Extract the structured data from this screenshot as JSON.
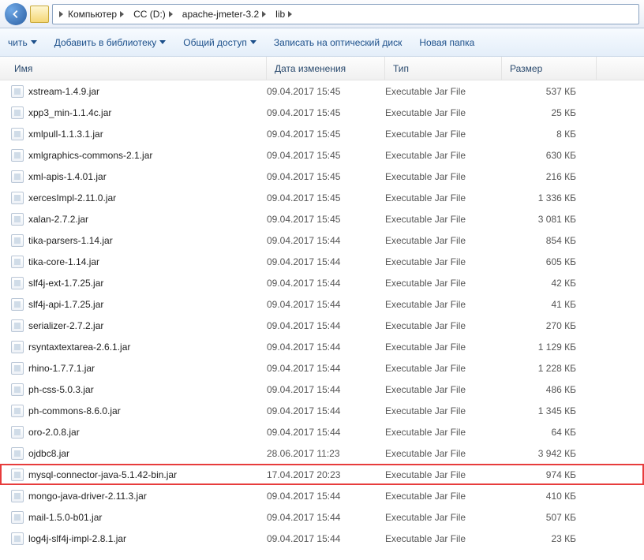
{
  "breadcrumbs": [
    "Компьютер",
    "CC (D:)",
    "apache-jmeter-3.2",
    "lib"
  ],
  "toolbar": {
    "organize": "чить",
    "addlib": "Добавить в библиотеку",
    "share": "Общий доступ",
    "burn": "Записать на оптический диск",
    "newfolder": "Новая папка"
  },
  "columns": {
    "name": "Имя",
    "date": "Дата изменения",
    "type": "Тип",
    "size": "Размер"
  },
  "files": [
    {
      "name": "xstream-1.4.9.jar",
      "date": "09.04.2017 15:45",
      "type": "Executable Jar File",
      "size": "537 КБ",
      "hl": false
    },
    {
      "name": "xpp3_min-1.1.4c.jar",
      "date": "09.04.2017 15:45",
      "type": "Executable Jar File",
      "size": "25 КБ",
      "hl": false
    },
    {
      "name": "xmlpull-1.1.3.1.jar",
      "date": "09.04.2017 15:45",
      "type": "Executable Jar File",
      "size": "8 КБ",
      "hl": false
    },
    {
      "name": "xmlgraphics-commons-2.1.jar",
      "date": "09.04.2017 15:45",
      "type": "Executable Jar File",
      "size": "630 КБ",
      "hl": false
    },
    {
      "name": "xml-apis-1.4.01.jar",
      "date": "09.04.2017 15:45",
      "type": "Executable Jar File",
      "size": "216 КБ",
      "hl": false
    },
    {
      "name": "xercesImpl-2.11.0.jar",
      "date": "09.04.2017 15:45",
      "type": "Executable Jar File",
      "size": "1 336 КБ",
      "hl": false
    },
    {
      "name": "xalan-2.7.2.jar",
      "date": "09.04.2017 15:45",
      "type": "Executable Jar File",
      "size": "3 081 КБ",
      "hl": false
    },
    {
      "name": "tika-parsers-1.14.jar",
      "date": "09.04.2017 15:44",
      "type": "Executable Jar File",
      "size": "854 КБ",
      "hl": false
    },
    {
      "name": "tika-core-1.14.jar",
      "date": "09.04.2017 15:44",
      "type": "Executable Jar File",
      "size": "605 КБ",
      "hl": false
    },
    {
      "name": "slf4j-ext-1.7.25.jar",
      "date": "09.04.2017 15:44",
      "type": "Executable Jar File",
      "size": "42 КБ",
      "hl": false
    },
    {
      "name": "slf4j-api-1.7.25.jar",
      "date": "09.04.2017 15:44",
      "type": "Executable Jar File",
      "size": "41 КБ",
      "hl": false
    },
    {
      "name": "serializer-2.7.2.jar",
      "date": "09.04.2017 15:44",
      "type": "Executable Jar File",
      "size": "270 КБ",
      "hl": false
    },
    {
      "name": "rsyntaxtextarea-2.6.1.jar",
      "date": "09.04.2017 15:44",
      "type": "Executable Jar File",
      "size": "1 129 КБ",
      "hl": false
    },
    {
      "name": "rhino-1.7.7.1.jar",
      "date": "09.04.2017 15:44",
      "type": "Executable Jar File",
      "size": "1 228 КБ",
      "hl": false
    },
    {
      "name": "ph-css-5.0.3.jar",
      "date": "09.04.2017 15:44",
      "type": "Executable Jar File",
      "size": "486 КБ",
      "hl": false
    },
    {
      "name": "ph-commons-8.6.0.jar",
      "date": "09.04.2017 15:44",
      "type": "Executable Jar File",
      "size": "1 345 КБ",
      "hl": false
    },
    {
      "name": "oro-2.0.8.jar",
      "date": "09.04.2017 15:44",
      "type": "Executable Jar File",
      "size": "64 КБ",
      "hl": false
    },
    {
      "name": "ojdbc8.jar",
      "date": "28.06.2017 11:23",
      "type": "Executable Jar File",
      "size": "3 942 КБ",
      "hl": false
    },
    {
      "name": "mysql-connector-java-5.1.42-bin.jar",
      "date": "17.04.2017 20:23",
      "type": "Executable Jar File",
      "size": "974 КБ",
      "hl": true
    },
    {
      "name": "mongo-java-driver-2.11.3.jar",
      "date": "09.04.2017 15:44",
      "type": "Executable Jar File",
      "size": "410 КБ",
      "hl": false
    },
    {
      "name": "mail-1.5.0-b01.jar",
      "date": "09.04.2017 15:44",
      "type": "Executable Jar File",
      "size": "507 КБ",
      "hl": false
    },
    {
      "name": "log4j-slf4j-impl-2.8.1.jar",
      "date": "09.04.2017 15:44",
      "type": "Executable Jar File",
      "size": "23 КБ",
      "hl": false
    }
  ]
}
